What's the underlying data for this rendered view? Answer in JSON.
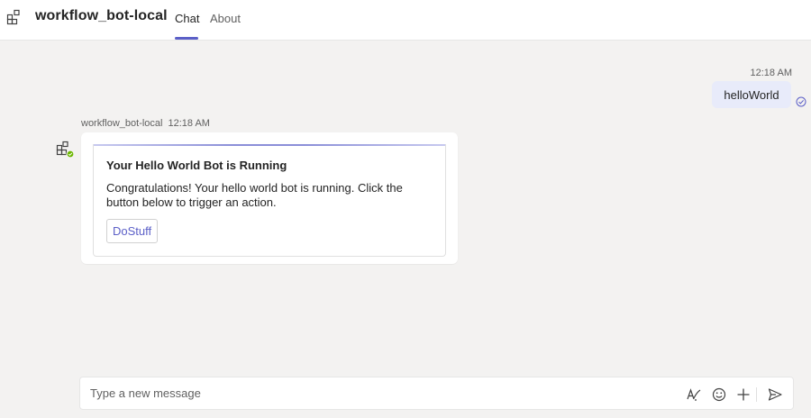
{
  "header": {
    "app_title": "workflow_bot-local",
    "app_icon": "apps-grid-icon",
    "tabs": [
      {
        "label": "Chat",
        "active": true
      },
      {
        "label": "About",
        "active": false
      }
    ],
    "accent_color": "#5b5fc7"
  },
  "sent_message": {
    "time": "12:18 AM",
    "text": "helloWorld",
    "status_icon": "sent-check-icon"
  },
  "bot_message": {
    "sender": "workflow_bot-local",
    "time": "12:18 AM",
    "avatar_icon": "apps-grid-icon",
    "presence": "available",
    "card": {
      "title": "Your Hello World Bot is Running",
      "body": "Congratulations! Your hello world bot is running. Click the button below to trigger an action.",
      "button_label": "DoStuff"
    }
  },
  "composer": {
    "placeholder": "Type a new message",
    "icons": [
      "format-icon",
      "emoji-icon",
      "plus-icon",
      "send-icon"
    ]
  }
}
